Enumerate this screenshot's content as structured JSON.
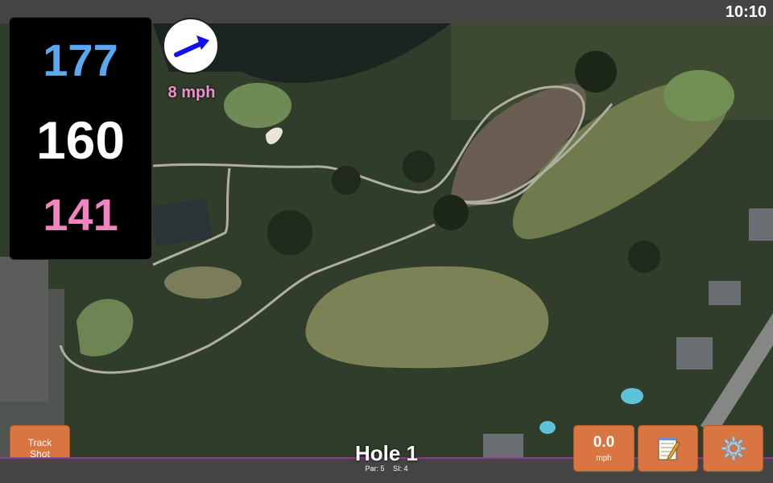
{
  "status_bar": {
    "time": "10:10"
  },
  "distances": {
    "back": "177",
    "middle": "160",
    "front": "141"
  },
  "wind": {
    "speed_label": "8 mph",
    "direction_icon": "arrow-icon"
  },
  "hole": {
    "title": "Hole 1",
    "par": "Par: 5",
    "si": "SI: 4"
  },
  "buttons": {
    "track_shot_line1": "Track",
    "track_shot_line2": "Shot",
    "speed_value": "0.0",
    "speed_unit": "mph",
    "notes_icon": "notepad-icon",
    "settings_icon": "gear-icon"
  },
  "colors": {
    "back": "#5aa9f0",
    "middle": "#ffffff",
    "front": "#f084c0",
    "button": "#d87540",
    "accent": "#8a3d8a"
  }
}
